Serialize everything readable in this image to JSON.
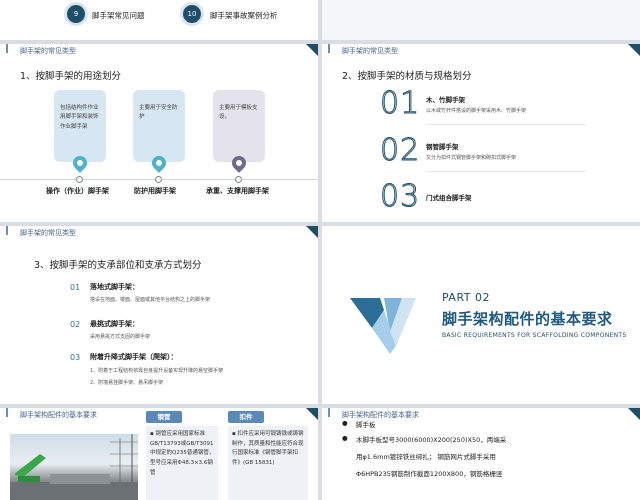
{
  "slide1": {
    "items": [
      {
        "num": "9",
        "label": "脚手架常见问题"
      },
      {
        "num": "10",
        "label": "脚手架事故案例分析"
      }
    ]
  },
  "slide3": {
    "header": "脚手架的常见类型",
    "section_title": "1、按脚手架的用途划分",
    "cards": [
      {
        "text": "包括结构件作业用脚手架和装饰作业脚手架",
        "label": "操作（作业）脚手架",
        "color": "#d6e6f2",
        "pin": "#4fb2c6"
      },
      {
        "text": "主要用于安全防护",
        "label": "防护用脚手架",
        "color": "#d6e6f2",
        "pin": "#4fb2c6"
      },
      {
        "text": "主要用于模板支设。",
        "label": "承重、支撑用脚手架",
        "color": "#e4e2ea",
        "pin": "#6e6a8a"
      }
    ]
  },
  "slide4": {
    "header": "脚手架的常见类型",
    "section_title": "2、按脚手架的材质与规格划分",
    "items": [
      {
        "num": "01",
        "title": "木、竹脚手架",
        "desc": "以木或竹杆件搭设的脚手架采用木、竹脚手架"
      },
      {
        "num": "02",
        "title": "钢管脚手架",
        "desc": "又分为扣件式钢管脚手架和碗扣式脚手架"
      },
      {
        "num": "03",
        "title": "门式组合脚手架",
        "desc": ""
      }
    ]
  },
  "slide5": {
    "header": "脚手架的常见类型",
    "section_title": "3、按脚手架的支承部位和支承方式划分",
    "items": [
      {
        "num": "01",
        "title": "落地式脚手架：",
        "desc": "搭设在地面、楼面、屋面或其他平台结构之上的脚手架"
      },
      {
        "num": "02",
        "title": "悬挑式脚手架：",
        "desc": "采用悬挑方式支固的脚手架"
      },
      {
        "num": "03",
        "title": "附着升降式脚手架（爬架）：",
        "desc": "1、附着于工程结构依靠自身提升设备实现升降的悬空脚手架",
        "desc2": "2、附墙悬挂脚手架、悬吊脚手架"
      }
    ]
  },
  "slide6": {
    "part": "PART 02",
    "title": "脚手架构配件的基本要求",
    "subtitle": "BASIC REQUIREMENTS FOR SCAFFOLDING COMPONENTS"
  },
  "slide7": {
    "header": "脚手架构配件的基本要求",
    "tag1": "钢管",
    "tag2": "扣件",
    "text1": "钢管应采用国家标准GB/T13793或GB/T3091中规定的Q235普通钢管，型号应采用Φ48.3×3.6钢管",
    "text2": "扣件应采用可锻铸铁或铸钢制作，其质量和性能应符合现行国家标准《钢管脚手架扣件》(GB 15831)"
  },
  "slide8": {
    "header": "脚手架构配件的基本要求",
    "lines": [
      "脚手板",
      "木脚手板型号3000(6000)X200(250)X50，两端采",
      "用φ1.6mm镀锌铁丝绑扎；   钢筋网片式脚手采用",
      "Φ6HPB235钢筋制作截面1200X800，钢筋格栅竖"
    ]
  },
  "colors": {
    "primary": "#1f4e6b",
    "accent": "#5a89b8",
    "teal": "#4fb2c6"
  }
}
